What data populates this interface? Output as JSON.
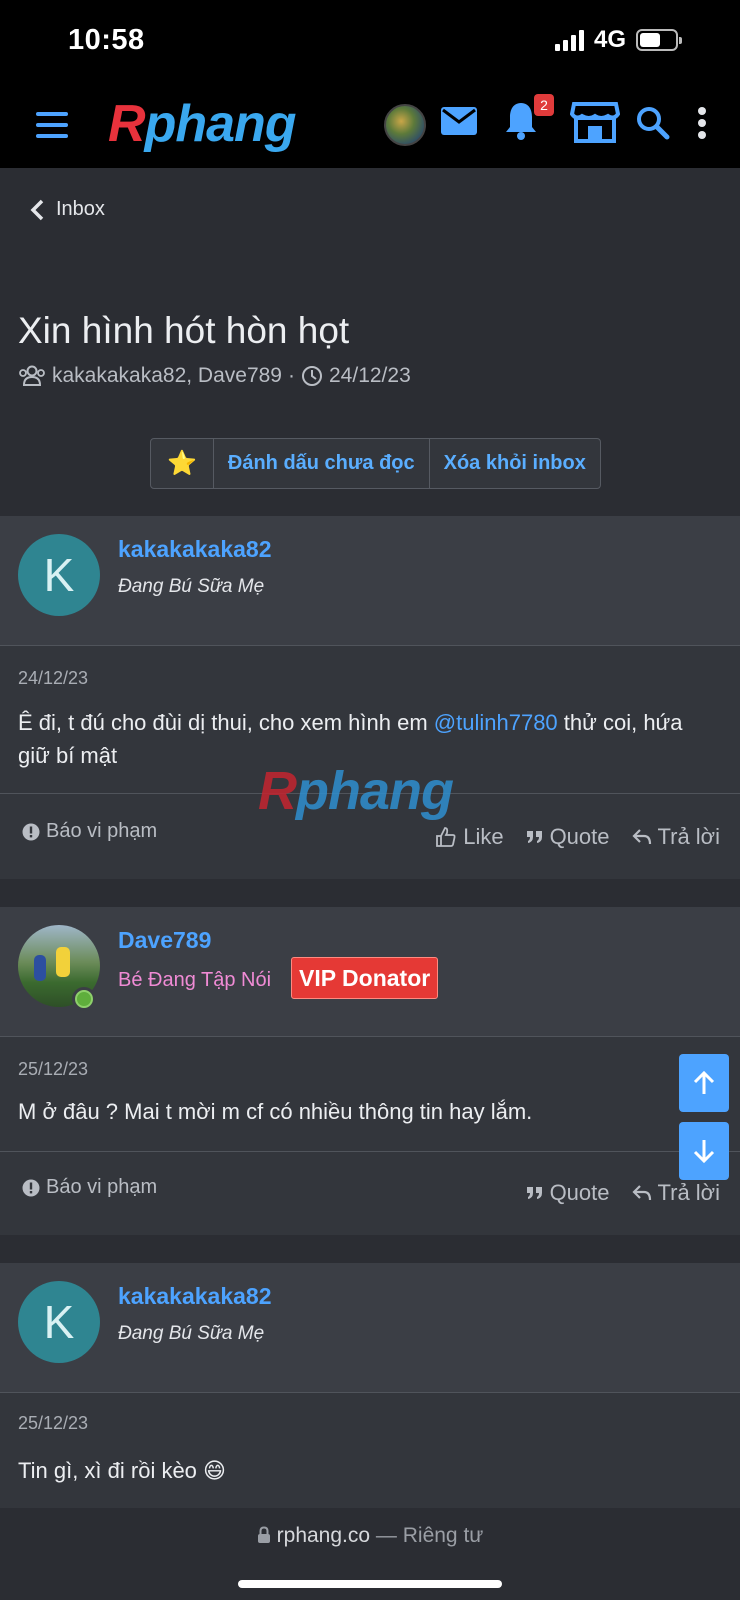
{
  "status": {
    "time": "10:58",
    "network": "4G"
  },
  "nav": {
    "logo_r": "R",
    "logo_rest": "phang",
    "notification_count": "2"
  },
  "header": {
    "back_label": "Inbox",
    "title": "Xin hình hót hòn họt",
    "participants": "kakakakaka82, Dave789",
    "separator": "·",
    "date": "24/12/23"
  },
  "actions": {
    "star": "⭐",
    "mark_unread": "Đánh dấu chưa đọc",
    "remove_inbox": "Xóa khỏi inbox"
  },
  "messages": [
    {
      "username": "kakakakaka82",
      "avatar_letter": "K",
      "user_title": "Đang Bú Sữa Mẹ",
      "date": "24/12/23",
      "body_before": "Ê đi, t đú cho đùi dị thui, cho xem hình em ",
      "mention": "@tulinh7780",
      "body_after": " thử coi, hứa giữ bí mật",
      "report": "Báo vi phạm",
      "like": "Like",
      "quote": "Quote",
      "reply": "Trả lời"
    },
    {
      "username": "Dave789",
      "user_title": "Bé Đang Tập Nói",
      "banner": "VIP Donator",
      "date": "25/12/23",
      "body": "M ở đâu ? Mai t mời m cf có nhiều thông tin hay lắm.",
      "report": "Báo vi phạm",
      "quote": "Quote",
      "reply": "Trả lời"
    },
    {
      "username": "kakakakaka82",
      "avatar_letter": "K",
      "user_title": "Đang Bú Sữa Mẹ",
      "date": "25/12/23",
      "body": "Tin gì, xì đi rồi kèo",
      "emoji": "😄"
    }
  ],
  "watermark": {
    "r": "R",
    "rest": "phang"
  },
  "browser": {
    "domain": "rphang.co",
    "dash": "—",
    "privacy": "Riêng tư"
  },
  "colors": {
    "accent": "#4da3ff",
    "background": "#2b2d33",
    "vip": "#e53935",
    "user_title_pink": "#f08bd5"
  }
}
